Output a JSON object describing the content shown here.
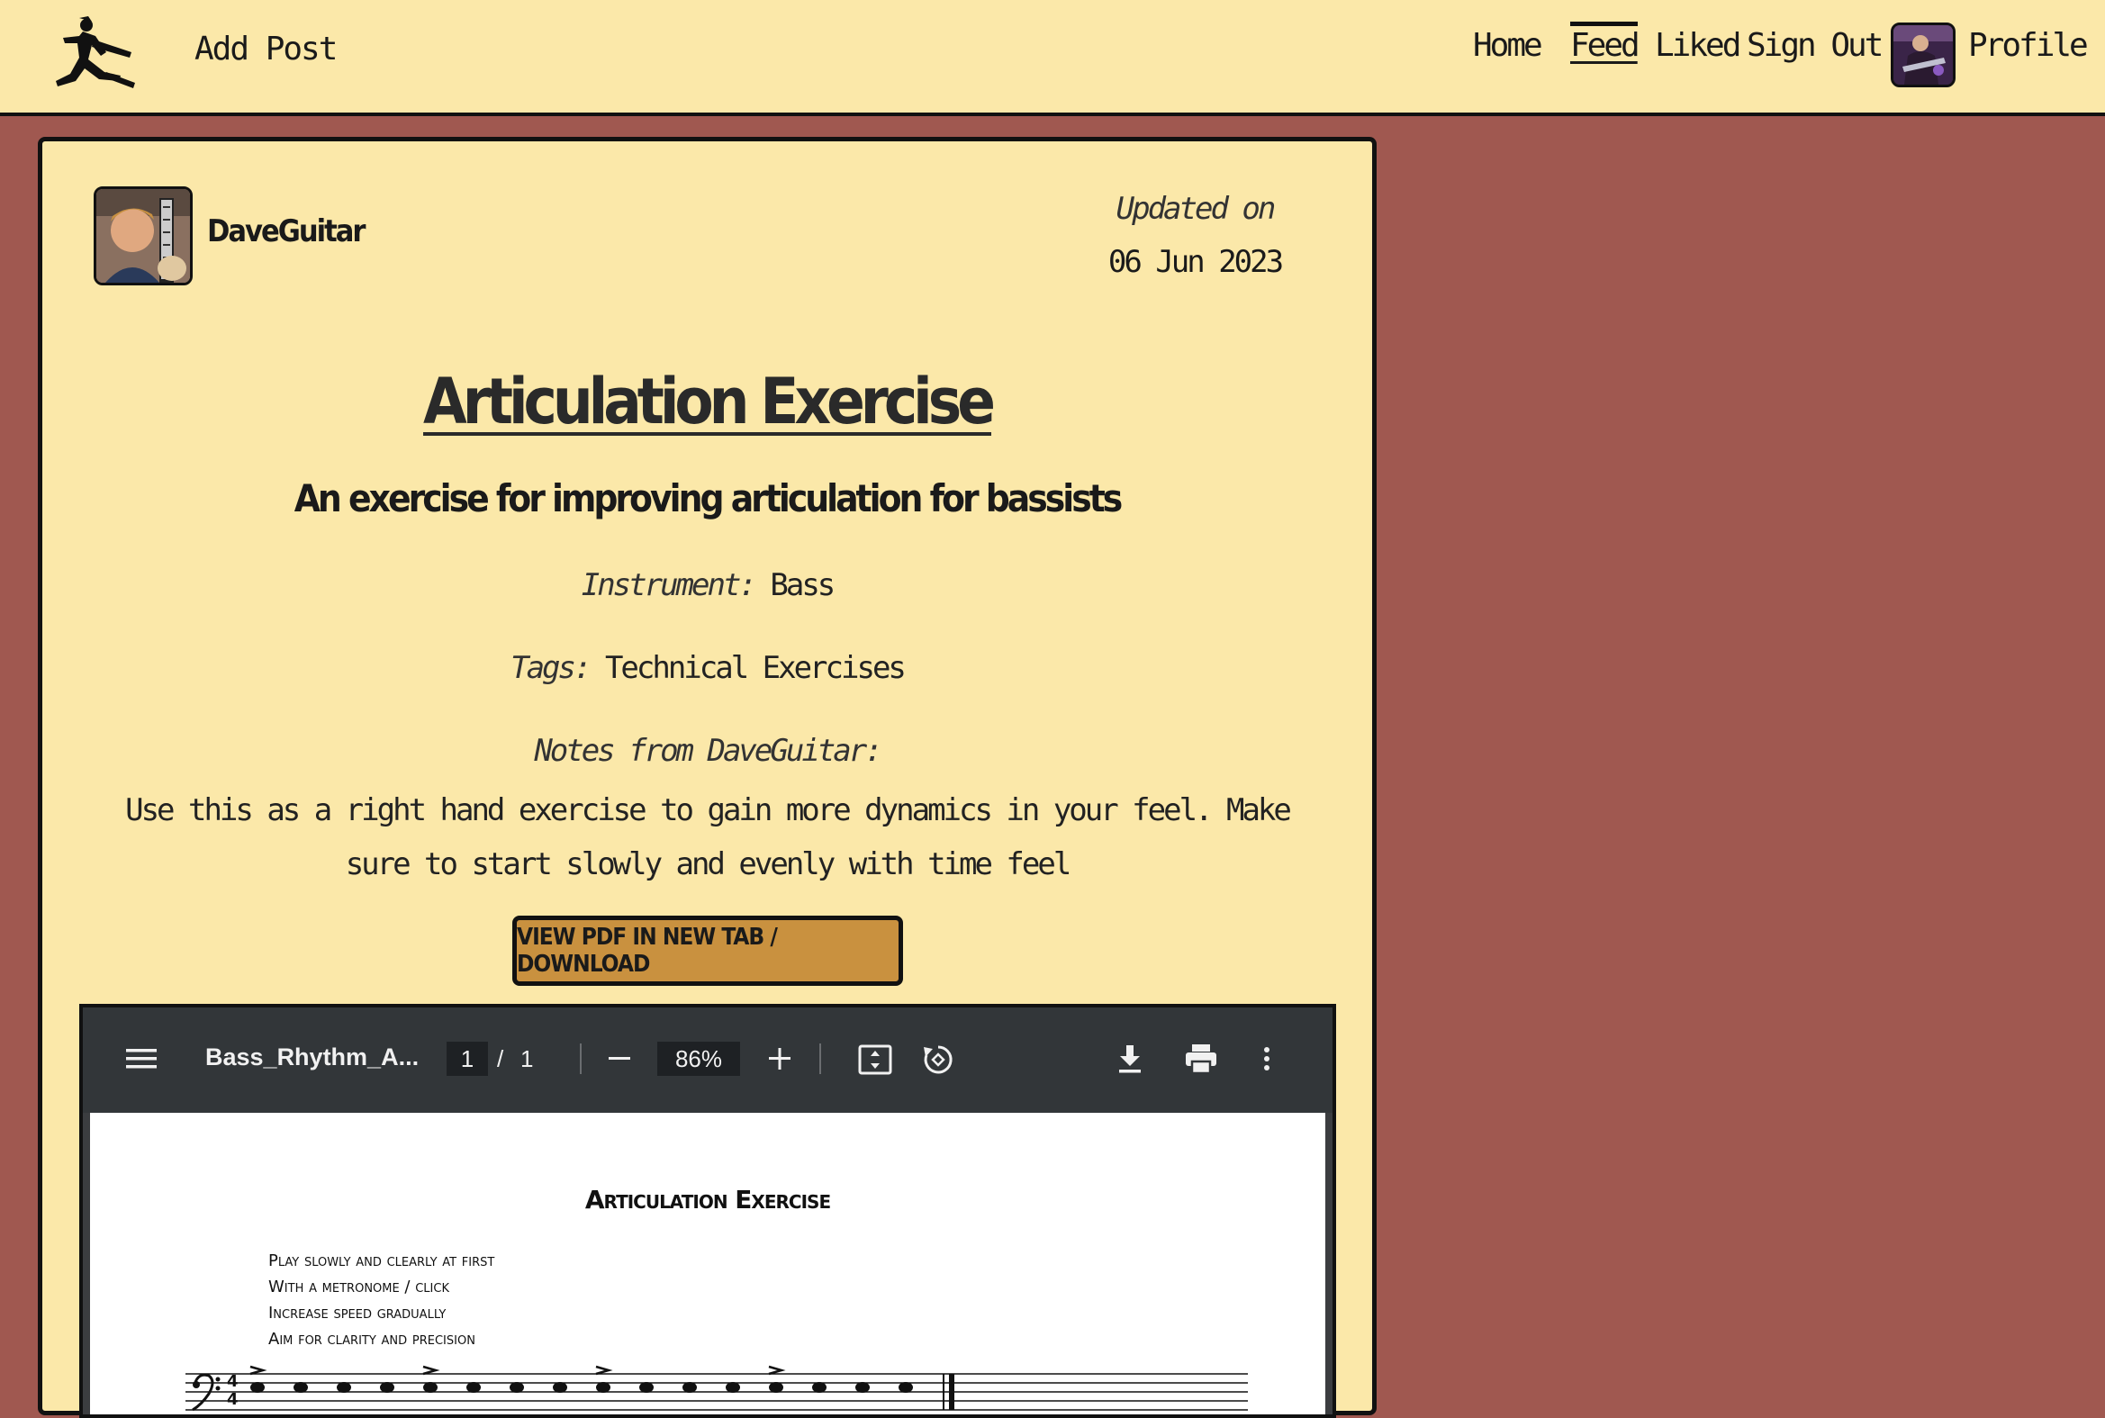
{
  "navbar": {
    "logo_icon": "guitarist-jumping-logo-icon",
    "add_post_label": "Add Post",
    "links": {
      "home": "Home",
      "feed": "Feed",
      "liked": "Liked",
      "sign_out": "Sign Out",
      "profile": "Profile"
    },
    "active_link": "Feed"
  },
  "post": {
    "author": "DaveGuitar",
    "updated_label": "Updated on",
    "updated_date": "06 Jun 2023",
    "title": "Articulation Exercise",
    "subtitle": "An exercise for improving articulation for bassists",
    "instrument_label": "Instrument:",
    "instrument": "Bass",
    "tags_label": "Tags:",
    "tags": "Technical Exercises",
    "notes_label": "Notes from DaveGuitar:",
    "notes": "Use this as a right hand exercise to gain more dynamics in your feel. Make sure to start slowly and evenly with time feel",
    "pdf_button": "VIEW PDF IN NEW TAB / DOWNLOAD"
  },
  "pdf_viewer": {
    "filename": "Bass_Rhythm_A...",
    "current_page": "1",
    "page_separator": "/",
    "total_pages": "1",
    "zoom": "86%",
    "sheet": {
      "title": "Articulation Exercise",
      "instructions": [
        "Play slowly and clearly at first",
        "With a metronome / click",
        "Increase speed gradually",
        "Aim for clarity and precision"
      ]
    }
  },
  "colors": {
    "page_background": "#a05850",
    "card_background": "#fbe8a9",
    "button_background": "#c9913f",
    "pdf_toolbar": "#323639"
  }
}
